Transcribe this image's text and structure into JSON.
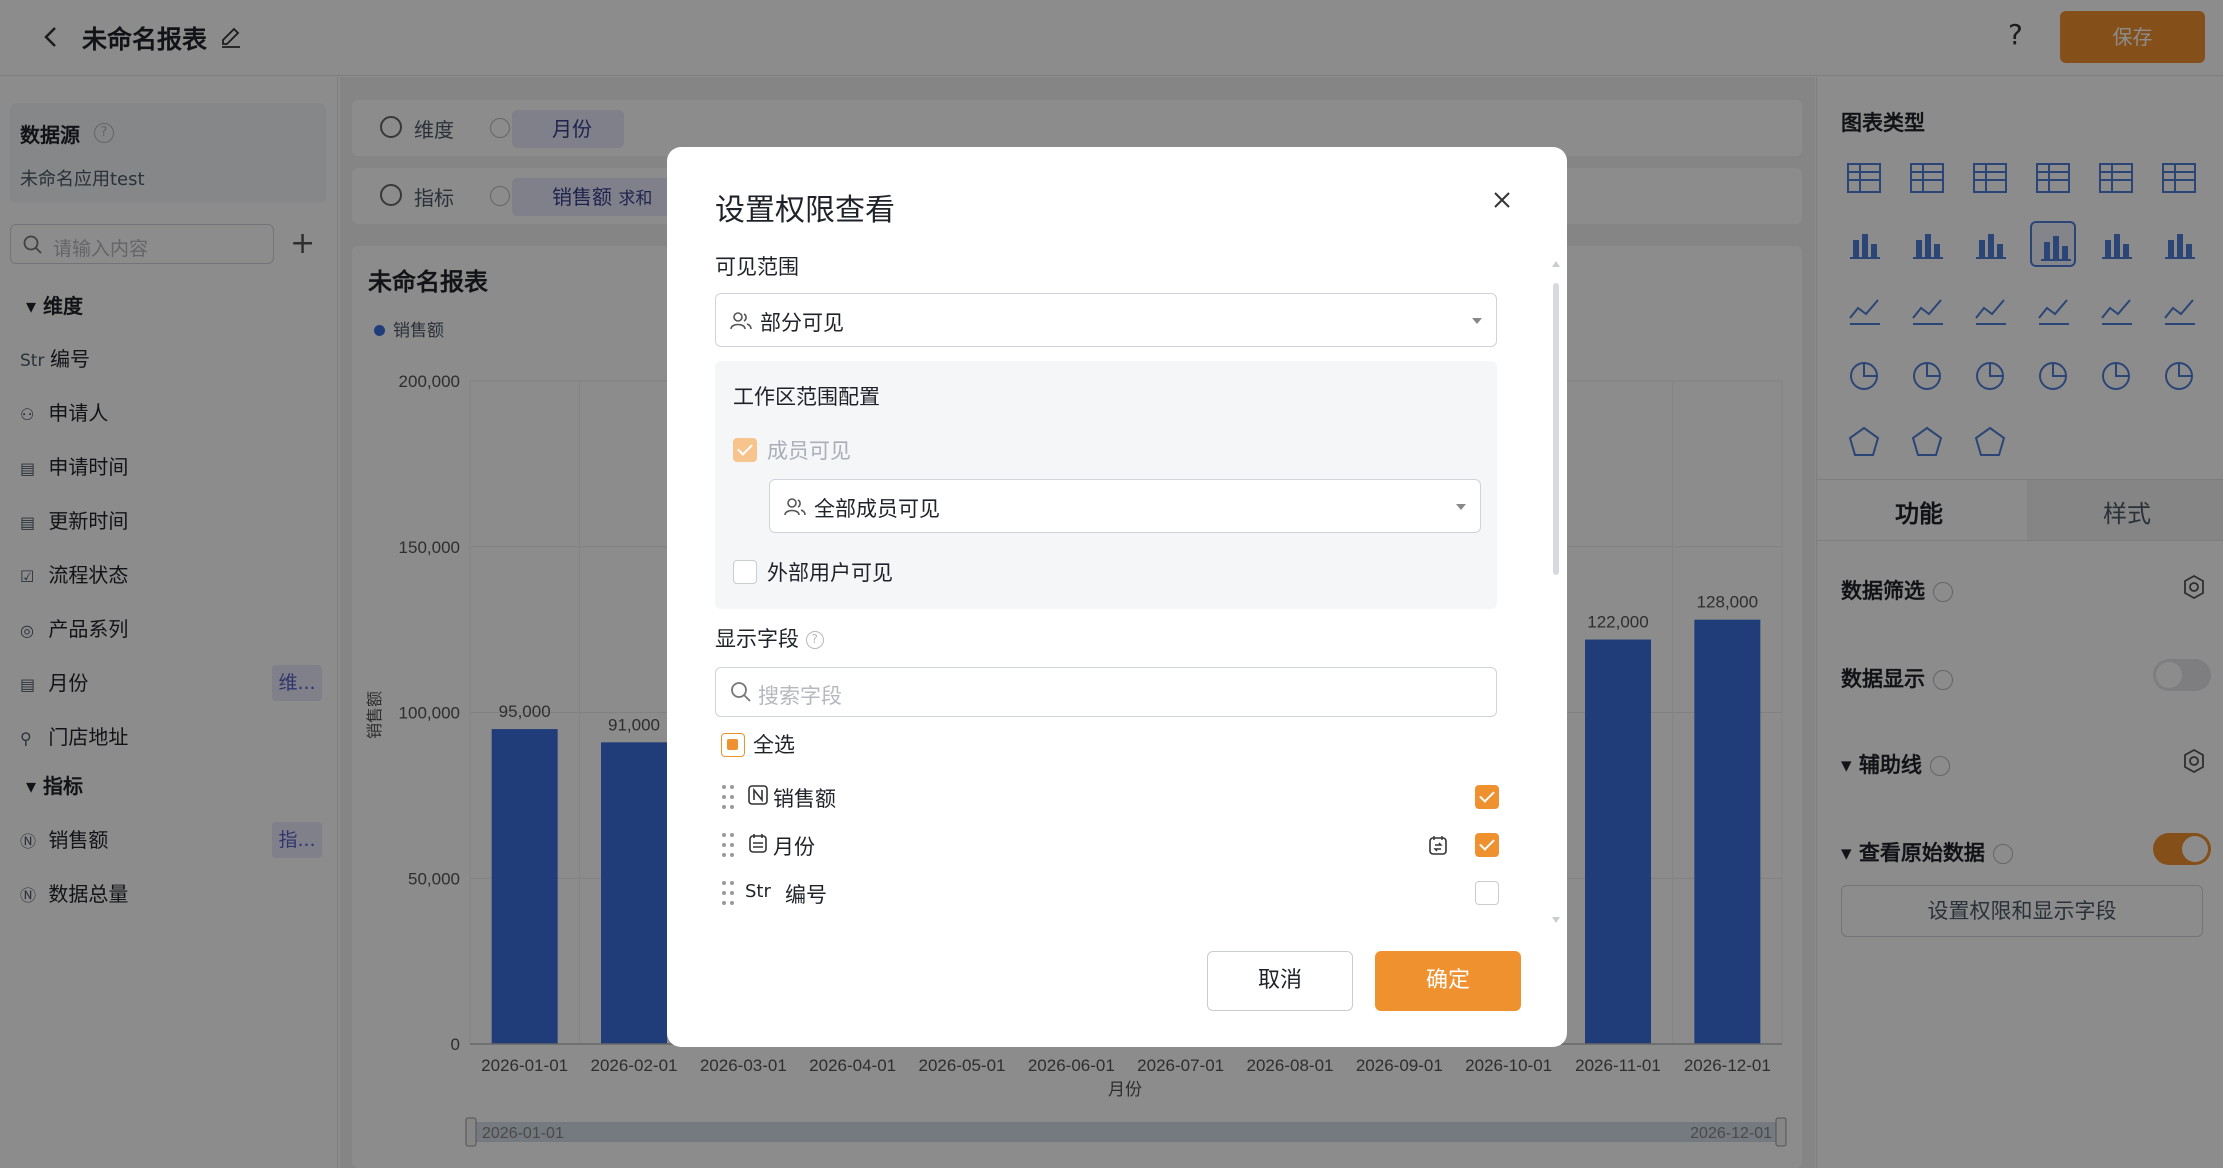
{
  "header": {
    "title": "未命名报表",
    "help": "?",
    "save_label": "保存"
  },
  "left": {
    "datasource_label": "数据源",
    "datasource_value": "未命名应用test",
    "search_placeholder": "请输入内容",
    "add": "+",
    "dim_section": "维度",
    "measure_section": "指标",
    "dims": [
      {
        "icon": "Str",
        "label": "编号"
      },
      {
        "icon": "user-icon",
        "label": "申请人"
      },
      {
        "icon": "calendar-icon",
        "label": "申请时间"
      },
      {
        "icon": "calendar-icon",
        "label": "更新时间"
      },
      {
        "icon": "checkbox-icon",
        "label": "流程状态"
      },
      {
        "icon": "radio-icon",
        "label": "产品系列"
      },
      {
        "icon": "calendar-icon",
        "label": "月份",
        "badge": "维..."
      },
      {
        "icon": "location-icon",
        "label": "门店地址"
      }
    ],
    "measures": [
      {
        "icon": "number-icon",
        "label": "销售额",
        "badge": "指..."
      },
      {
        "icon": "number-icon",
        "label": "数据总量"
      }
    ]
  },
  "config": {
    "dim_label": "维度",
    "dim_pill": "月份",
    "measure_label": "指标",
    "measure_pill": "销售额",
    "measure_agg": "求和"
  },
  "chart_data": {
    "type": "bar",
    "title": "未命名报表",
    "categories": [
      "2026-01-01",
      "2026-02-01",
      "2026-03-01",
      "2026-04-01",
      "2026-05-01",
      "2026-06-01",
      "2026-07-01",
      "2026-08-01",
      "2026-09-01",
      "2026-10-01",
      "2026-11-01",
      "2026-12-01"
    ],
    "series": [
      {
        "name": "销售额",
        "values": [
          95000,
          91000,
          null,
          null,
          null,
          null,
          null,
          null,
          null,
          null,
          122000,
          128000
        ]
      }
    ],
    "value_labels": [
      "95,000",
      "91,000",
      "",
      "",
      "",
      "",
      "",
      "",
      "",
      "",
      "122,000",
      "128,000"
    ],
    "xlabel": "月份",
    "ylabel": "销售额",
    "ylim": [
      0,
      200000
    ],
    "yticks": [
      "200,000",
      "150,000",
      "100,000",
      "50,000",
      "0"
    ],
    "color": "#3b6fdc",
    "range_start": "2026-01-01",
    "range_end": "2026-12-01"
  },
  "right": {
    "chart_type_label": "图表类型",
    "tab_function": "功能",
    "tab_style": "样式",
    "data_filter": "数据筛选",
    "data_display": "数据显示",
    "aux_line": "辅助线",
    "view_raw": "查看原始数据",
    "perm_button": "设置权限和显示字段",
    "data_display_on": false,
    "view_raw_on": true
  },
  "modal": {
    "title": "设置权限查看",
    "visible_scope_label": "可见范围",
    "visible_scope_value": "部分可见",
    "workspace_label": "工作区范围配置",
    "member_visible": "成员可见",
    "member_scope_value": "全部成员可见",
    "external_visible": "外部用户可见",
    "fields_label": "显示字段",
    "field_search_placeholder": "搜索字段",
    "select_all": "全选",
    "fields": [
      {
        "icon": "number-icon",
        "label": "销售额",
        "checked": true
      },
      {
        "icon": "calendar-icon",
        "label": "月份",
        "checked": true
      },
      {
        "icon": "Str",
        "label": "编号",
        "checked": false
      }
    ],
    "cancel": "取消",
    "ok": "确定"
  },
  "colors": {
    "accent": "#f0912f",
    "bar": "#3b6fdc",
    "pill": "#e8e9fb"
  }
}
